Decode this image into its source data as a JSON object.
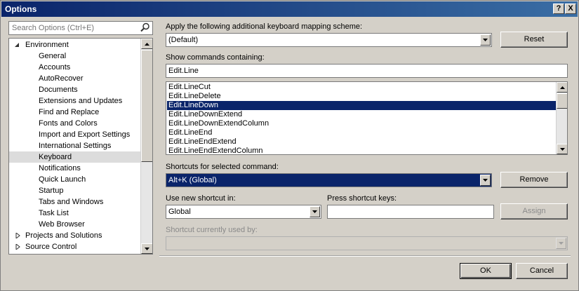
{
  "window": {
    "title": "Options",
    "help_label": "?",
    "close_label": "X"
  },
  "search": {
    "placeholder": "Search Options (Ctrl+E)"
  },
  "tree": {
    "items": [
      {
        "label": "Environment",
        "level": 0,
        "expanded": true
      },
      {
        "label": "General",
        "level": 1
      },
      {
        "label": "Accounts",
        "level": 1
      },
      {
        "label": "AutoRecover",
        "level": 1
      },
      {
        "label": "Documents",
        "level": 1
      },
      {
        "label": "Extensions and Updates",
        "level": 1
      },
      {
        "label": "Find and Replace",
        "level": 1
      },
      {
        "label": "Fonts and Colors",
        "level": 1
      },
      {
        "label": "Import and Export Settings",
        "level": 1
      },
      {
        "label": "International Settings",
        "level": 1
      },
      {
        "label": "Keyboard",
        "level": 1,
        "selected": true
      },
      {
        "label": "Notifications",
        "level": 1
      },
      {
        "label": "Quick Launch",
        "level": 1
      },
      {
        "label": "Startup",
        "level": 1
      },
      {
        "label": "Tabs and Windows",
        "level": 1
      },
      {
        "label": "Task List",
        "level": 1
      },
      {
        "label": "Web Browser",
        "level": 1
      },
      {
        "label": "Projects and Solutions",
        "level": 0,
        "expanded": false
      },
      {
        "label": "Source Control",
        "level": 0,
        "expanded": false
      }
    ]
  },
  "mapping": {
    "label": "Apply the following additional keyboard mapping scheme:",
    "value": "(Default)",
    "reset_label": "Reset"
  },
  "show_commands": {
    "label": "Show commands containing:",
    "value": "Edit.Line"
  },
  "commands": {
    "items": [
      "Edit.LineCut",
      "Edit.LineDelete",
      "Edit.LineDown",
      "Edit.LineDownExtend",
      "Edit.LineDownExtendColumn",
      "Edit.LineEnd",
      "Edit.LineEndExtend",
      "Edit.LineEndExtendColumn"
    ],
    "selected": "Edit.LineDown"
  },
  "shortcuts": {
    "label": "Shortcuts for selected command:",
    "value": "Alt+K (Global)",
    "remove_label": "Remove"
  },
  "use_new": {
    "label": "Use new shortcut in:",
    "value": "Global"
  },
  "press_keys": {
    "label": "Press shortcut keys:",
    "value": "",
    "assign_label": "Assign"
  },
  "used_by": {
    "label": "Shortcut currently used by:",
    "value": ""
  },
  "footer": {
    "ok_label": "OK",
    "cancel_label": "Cancel"
  },
  "colors": {
    "selection": "#0a246a",
    "tree_selection": "#dcdcdc",
    "dialog_bg": "#d4d0c8"
  }
}
